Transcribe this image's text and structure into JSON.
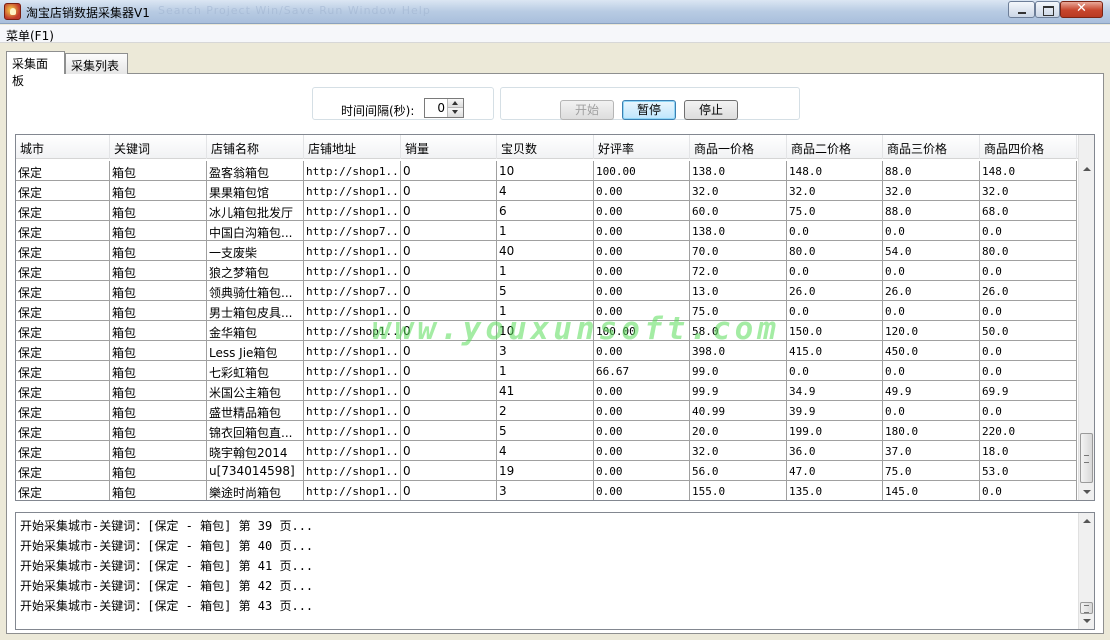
{
  "window": {
    "title": "淘宝店销数据采集器V1",
    "ghost_menu": "Search Project Win/Save Run Window Help"
  },
  "menu": {
    "item": "菜单(F1)"
  },
  "tabs": [
    "采集面板",
    "采集列表"
  ],
  "controls": {
    "interval_label": "时间间隔(秒):",
    "interval_value": "0",
    "start": "开始",
    "pause": "暂停",
    "stop": "停止"
  },
  "grid": {
    "columns": [
      "城市",
      "关键词",
      "店铺名称",
      "店铺地址",
      "销量",
      "宝贝数",
      "好评率",
      "商品一价格",
      "商品二价格",
      "商品三价格",
      "商品四价格"
    ],
    "rows": [
      [
        "保定",
        "箱包",
        "盈客翁箱包",
        "http://shop1...",
        "0",
        "10",
        "100.00",
        "138.0",
        "148.0",
        "88.0",
        "148.0"
      ],
      [
        "保定",
        "箱包",
        "果果箱包馆",
        "http://shop1...",
        "0",
        "4",
        "0.00",
        "32.0",
        "32.0",
        "32.0",
        "32.0"
      ],
      [
        "保定",
        "箱包",
        "冰儿箱包批发厅",
        "http://shop1...",
        "0",
        "6",
        "0.00",
        "60.0",
        "75.0",
        "88.0",
        "68.0"
      ],
      [
        "保定",
        "箱包",
        "中国白沟箱包...",
        "http://shop7...",
        "0",
        "1",
        "0.00",
        "138.0",
        "0.0",
        "0.0",
        "0.0"
      ],
      [
        "保定",
        "箱包",
        "一支废柴",
        "http://shop1...",
        "0",
        "40",
        "0.00",
        "70.0",
        "80.0",
        "54.0",
        "80.0"
      ],
      [
        "保定",
        "箱包",
        "狼之梦箱包",
        "http://shop1...",
        "0",
        "1",
        "0.00",
        "72.0",
        "0.0",
        "0.0",
        "0.0"
      ],
      [
        "保定",
        "箱包",
        "领典骑仕箱包...",
        "http://shop7...",
        "0",
        "5",
        "0.00",
        "13.0",
        "26.0",
        "26.0",
        "26.0"
      ],
      [
        "保定",
        "箱包",
        "男士箱包皮具...",
        "http://shop1...",
        "0",
        "1",
        "0.00",
        "75.0",
        "0.0",
        "0.0",
        "0.0"
      ],
      [
        "保定",
        "箱包",
        "金华箱包",
        "http://shop1...",
        "0",
        "10",
        "100.00",
        "58.0",
        "150.0",
        "120.0",
        "50.0"
      ],
      [
        "保定",
        "箱包",
        "Less Jie箱包",
        "http://shop1...",
        "0",
        "3",
        "0.00",
        "398.0",
        "415.0",
        "450.0",
        "0.0"
      ],
      [
        "保定",
        "箱包",
        "七彩虹箱包",
        "http://shop1...",
        "0",
        "1",
        "66.67",
        "99.0",
        "0.0",
        "0.0",
        "0.0"
      ],
      [
        "保定",
        "箱包",
        "米国公主箱包",
        "http://shop1...",
        "0",
        "41",
        "0.00",
        "99.9",
        "34.9",
        "49.9",
        "69.9"
      ],
      [
        "保定",
        "箱包",
        "盛世精品箱包",
        "http://shop1...",
        "0",
        "2",
        "0.00",
        "40.99",
        "39.9",
        "0.0",
        "0.0"
      ],
      [
        "保定",
        "箱包",
        "锦衣回箱包直...",
        "http://shop1...",
        "0",
        "5",
        "0.00",
        "20.0",
        "199.0",
        "180.0",
        "220.0"
      ],
      [
        "保定",
        "箱包",
        "晓宇翰包2014",
        "http://shop1...",
        "0",
        "4",
        "0.00",
        "32.0",
        "36.0",
        "37.0",
        "18.0"
      ],
      [
        "保定",
        "箱包",
        "u[734014598]",
        "http://shop1...",
        "0",
        "19",
        "0.00",
        "56.0",
        "47.0",
        "75.0",
        "53.0"
      ],
      [
        "保定",
        "箱包",
        "樂途时尚箱包",
        "http://shop1...",
        "0",
        "3",
        "0.00",
        "155.0",
        "135.0",
        "145.0",
        "0.0"
      ]
    ]
  },
  "watermark": "www.youxunsoft.com",
  "log": [
    "开始采集城市-关键词：[保定 - 箱包] 第 39 页...",
    "开始采集城市-关键词：[保定 - 箱包] 第 40 页...",
    "开始采集城市-关键词：[保定 - 箱包] 第 41 页...",
    "开始采集城市-关键词：[保定 - 箱包] 第 42 页...",
    "开始采集城市-关键词：[保定 - 箱包] 第 43 页..."
  ],
  "icons": {
    "app": "bag-app-icon",
    "minimize": "minimize-icon",
    "maximize": "maximize-icon",
    "close": "close-icon"
  }
}
